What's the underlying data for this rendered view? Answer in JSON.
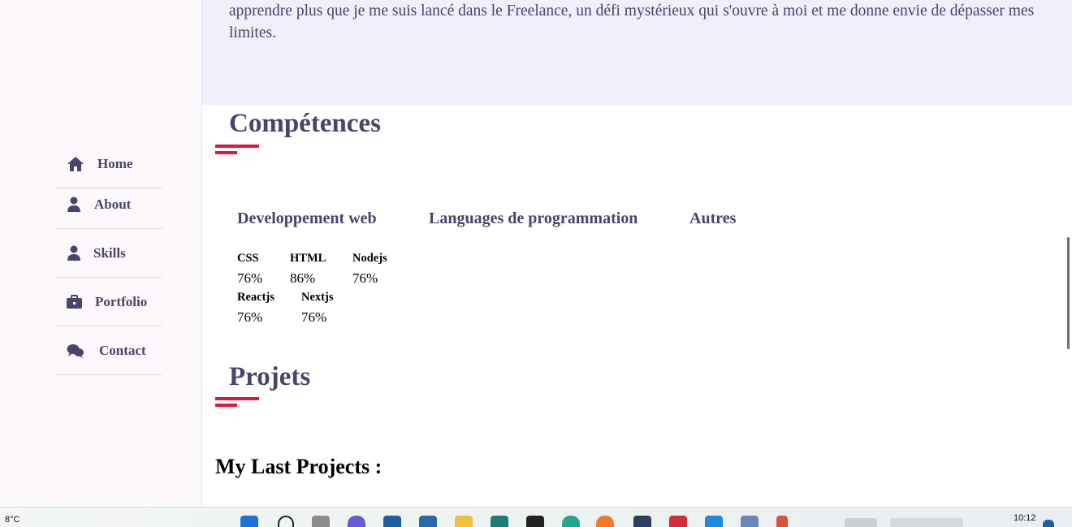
{
  "sidebar": {
    "items": [
      {
        "label": "Home",
        "icon": "home-icon"
      },
      {
        "label": "About",
        "icon": "user-icon"
      },
      {
        "label": "Skills",
        "icon": "user-icon"
      },
      {
        "label": "Portfolio",
        "icon": "briefcase-icon"
      },
      {
        "label": "Contact",
        "icon": "chat-icon"
      }
    ]
  },
  "about": {
    "text": "apprendre plus que je me suis lancé dans le Freelance, un défi mystérieux qui s'ouvre à moi et me donne envie de dépasser mes limites."
  },
  "skills": {
    "title": "Compétences",
    "tabs": [
      "Developpement web",
      "Languages de programmation",
      "Autres"
    ],
    "items": [
      {
        "name": "CSS",
        "value": "76%"
      },
      {
        "name": "HTML",
        "value": "86%"
      },
      {
        "name": "Nodejs",
        "value": "76%"
      },
      {
        "name": "Reactjs",
        "value": "76%"
      },
      {
        "name": "Nextjs",
        "value": "76%"
      }
    ]
  },
  "projects": {
    "title": "Projets",
    "subtitle": "My Last Projects :"
  },
  "taskbar": {
    "weather": "8°C",
    "time": "10:12"
  },
  "colors": {
    "text": "#47456b",
    "accent": "#e0163c",
    "sidebar_bg": "#fdf8fc",
    "about_bg": "#f0effa"
  }
}
